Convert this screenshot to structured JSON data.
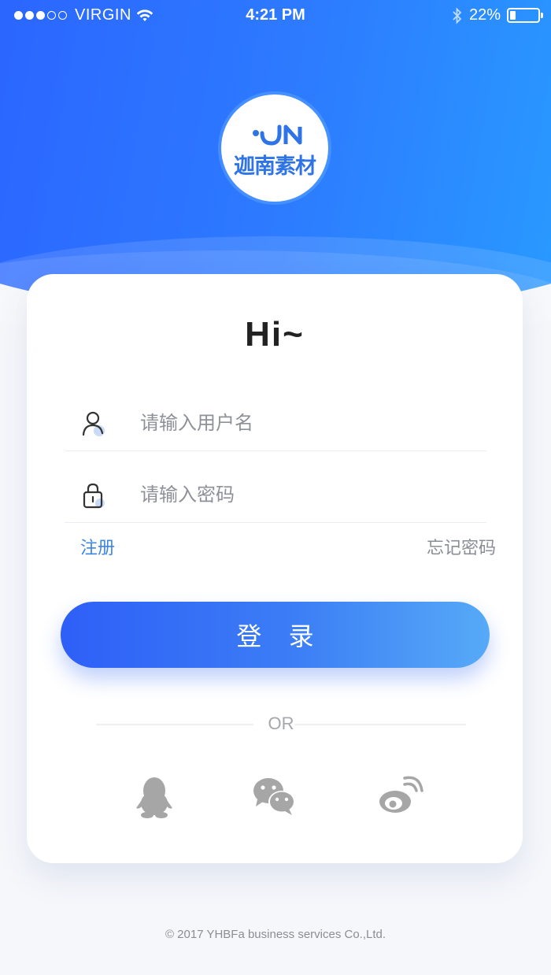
{
  "status_bar": {
    "signal_dots_filled": 3,
    "signal_dots_total": 5,
    "carrier": "VIRGIN",
    "time": "4:21 PM",
    "battery_text": "22%",
    "battery_level": 0.22
  },
  "logo": {
    "text": "迦南素材",
    "mark": "JN"
  },
  "login_card": {
    "greeting": "Hi~",
    "username_placeholder": "请输入用户名",
    "password_placeholder": "请输入密码",
    "register_link": "注册",
    "forgot_link": "忘记密码",
    "login_button": "登录",
    "divider_text": "OR",
    "social_logins": [
      "qq-icon",
      "wechat-icon",
      "weibo-icon"
    ]
  },
  "footer": {
    "copyright": "© 2017 YHBFa business services Co.,Ltd."
  },
  "colors": {
    "brand_blue": "#2d7bff",
    "button_start": "#2e5ff7",
    "button_end": "#56aaf7",
    "link_blue": "#3d86e6",
    "icon_gray": "#a6a6a6"
  }
}
